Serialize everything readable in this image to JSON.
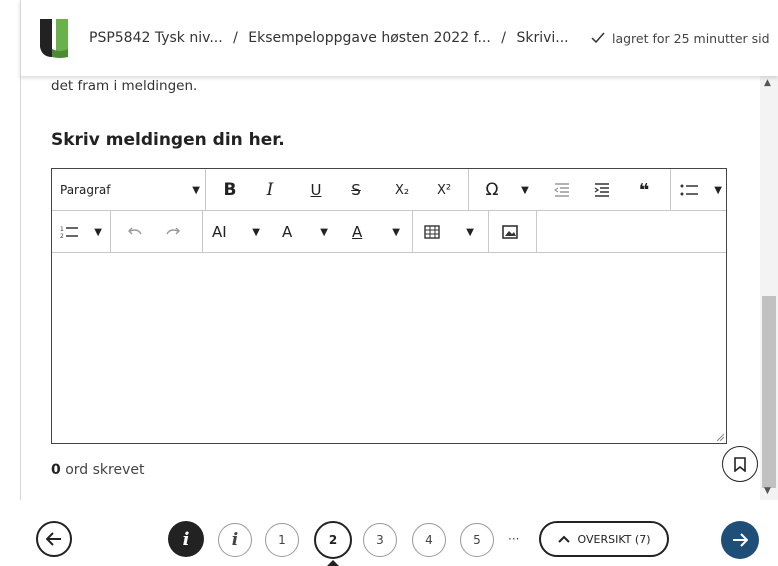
{
  "header": {
    "breadcrumbs": [
      "PSP5842 Tysk niv...",
      "Eksempeloppgave høsten 2022 f...",
      "Skrivi..."
    ],
    "separator": "/",
    "saved_status": "lagret for 25 minutter sid",
    "brand_colors": {
      "logo_dark": "#222222",
      "logo_green": "#6ab04c"
    }
  },
  "content": {
    "intro_text": "det fram i meldingen.",
    "heading": "Skriv meldingen din her."
  },
  "editor": {
    "paragraph_select": "Paragraf",
    "toolbar_row1": [
      "bold-icon",
      "italic-icon",
      "underline-icon",
      "strikethrough-icon",
      "subscript-icon",
      "superscript-icon",
      "omega-icon",
      "outdent-icon",
      "indent-icon",
      "blockquote-icon",
      "bullet-list-icon"
    ],
    "toolbar_row2": [
      "numbered-list-icon",
      "undo-icon",
      "redo-icon",
      "font-size-icon",
      "font-family-icon",
      "font-color-icon",
      "table-icon",
      "image-icon"
    ],
    "labels": {
      "bold": "B",
      "italic": "I",
      "underline": "U",
      "strike": "S",
      "subscript": "X₂",
      "superscript": "X²",
      "omega": "Ω",
      "quote": "❝",
      "font_size": "AI",
      "font_family": "A",
      "font_color": "A"
    },
    "content": ""
  },
  "wordcount": {
    "count": "0",
    "label": "ord skrevet"
  },
  "footer": {
    "pages": [
      "1",
      "2",
      "3",
      "4",
      "5"
    ],
    "active_page": "2",
    "ellipsis": "···",
    "overview_label": "OVERSIKT (7)",
    "info_label": "i",
    "accent": "#1f4e79"
  }
}
